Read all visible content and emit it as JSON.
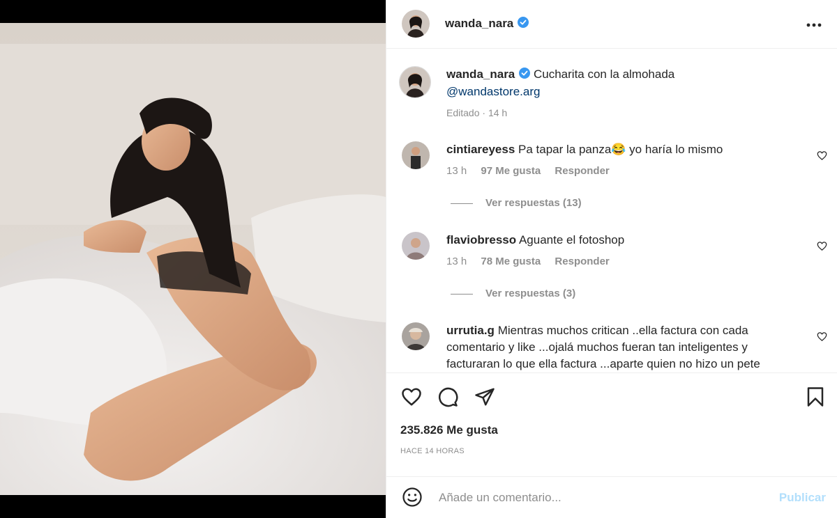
{
  "post": {
    "username": "wanda_nara",
    "caption": "Cucharita con la almohada",
    "mention": "@wandastore.arg",
    "edited_label": "Editado",
    "caption_age": "14 h"
  },
  "comments": [
    {
      "username": "cintiareyess",
      "text": "Pa tapar la panza😂 yo haría lo mismo",
      "age": "13 h",
      "likes": "97 Me gusta",
      "reply_label": "Responder",
      "view_replies": "Ver respuestas (13)"
    },
    {
      "username": "flaviobresso",
      "text": "Aguante el fotoshop",
      "age": "13 h",
      "likes": "78 Me gusta",
      "reply_label": "Responder",
      "view_replies": "Ver respuestas (3)"
    },
    {
      "username": "urrutia.g",
      "text": "Mientras muchos critican ..ella factura con cada comentario y like ...ojalá muchos fueran tan inteligentes y facturaran lo que ella factura ...aparte quien no hizo un pete"
    }
  ],
  "stats": {
    "likes": "235.826 Me gusta",
    "time": "HACE 14 HORAS"
  },
  "compose": {
    "placeholder": "Añade un comentario...",
    "publish_label": "Publicar"
  },
  "icons": {
    "more": "more-options-icon",
    "verified": "verified-badge-icon",
    "like": "heart-icon",
    "comment": "comment-icon",
    "share": "share-icon",
    "save": "bookmark-icon",
    "emoji": "emoji-icon"
  },
  "colors": {
    "verified": "#3897f0",
    "mention": "#00376b",
    "muted": "#8e8e8e",
    "publish_disabled": "#b2dffc"
  }
}
